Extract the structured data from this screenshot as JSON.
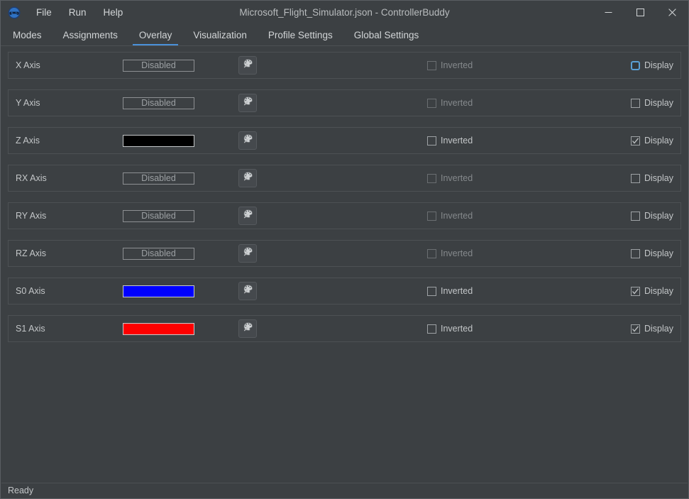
{
  "window": {
    "title": "Microsoft_Flight_Simulator.json - ControllerBuddy",
    "app_icon": "gamepad-icon",
    "controls": {
      "minimize": "minimize-icon",
      "maximize": "maximize-icon",
      "close": "close-icon"
    }
  },
  "menu": {
    "items": [
      {
        "label": "File"
      },
      {
        "label": "Run"
      },
      {
        "label": "Help"
      }
    ]
  },
  "tabs": {
    "active": "Overlay",
    "accent_color": "#4a90d9",
    "items": [
      {
        "label": "Modes"
      },
      {
        "label": "Assignments"
      },
      {
        "label": "Overlay"
      },
      {
        "label": "Visualization"
      },
      {
        "label": "Profile Settings"
      },
      {
        "label": "Global Settings"
      }
    ]
  },
  "overlay": {
    "palette_icon": "color-palette-icon",
    "inverted_label": "Inverted",
    "display_label": "Display",
    "disabled_label": "Disabled",
    "rows": [
      {
        "axis": "X Axis",
        "color": null,
        "color_text": "Disabled",
        "inverted": {
          "checked": false,
          "enabled": false
        },
        "display": {
          "checked": false,
          "enabled": true,
          "focused": true
        }
      },
      {
        "axis": "Y Axis",
        "color": null,
        "color_text": "Disabled",
        "inverted": {
          "checked": false,
          "enabled": false
        },
        "display": {
          "checked": false,
          "enabled": true,
          "focused": false
        }
      },
      {
        "axis": "Z Axis",
        "color": "#000000",
        "color_text": "",
        "inverted": {
          "checked": false,
          "enabled": true
        },
        "display": {
          "checked": true,
          "enabled": true,
          "focused": false
        }
      },
      {
        "axis": "RX Axis",
        "color": null,
        "color_text": "Disabled",
        "inverted": {
          "checked": false,
          "enabled": false
        },
        "display": {
          "checked": false,
          "enabled": true,
          "focused": false
        }
      },
      {
        "axis": "RY Axis",
        "color": null,
        "color_text": "Disabled",
        "inverted": {
          "checked": false,
          "enabled": false
        },
        "display": {
          "checked": false,
          "enabled": true,
          "focused": false
        }
      },
      {
        "axis": "RZ Axis",
        "color": null,
        "color_text": "Disabled",
        "inverted": {
          "checked": false,
          "enabled": false
        },
        "display": {
          "checked": false,
          "enabled": true,
          "focused": false
        }
      },
      {
        "axis": "S0 Axis",
        "color": "#0000FF",
        "color_text": "",
        "inverted": {
          "checked": false,
          "enabled": true
        },
        "display": {
          "checked": true,
          "enabled": true,
          "focused": false
        }
      },
      {
        "axis": "S1 Axis",
        "color": "#FF0000",
        "color_text": "",
        "inverted": {
          "checked": false,
          "enabled": true
        },
        "display": {
          "checked": true,
          "enabled": true,
          "focused": false
        }
      }
    ]
  },
  "statusbar": {
    "text": "Ready"
  }
}
